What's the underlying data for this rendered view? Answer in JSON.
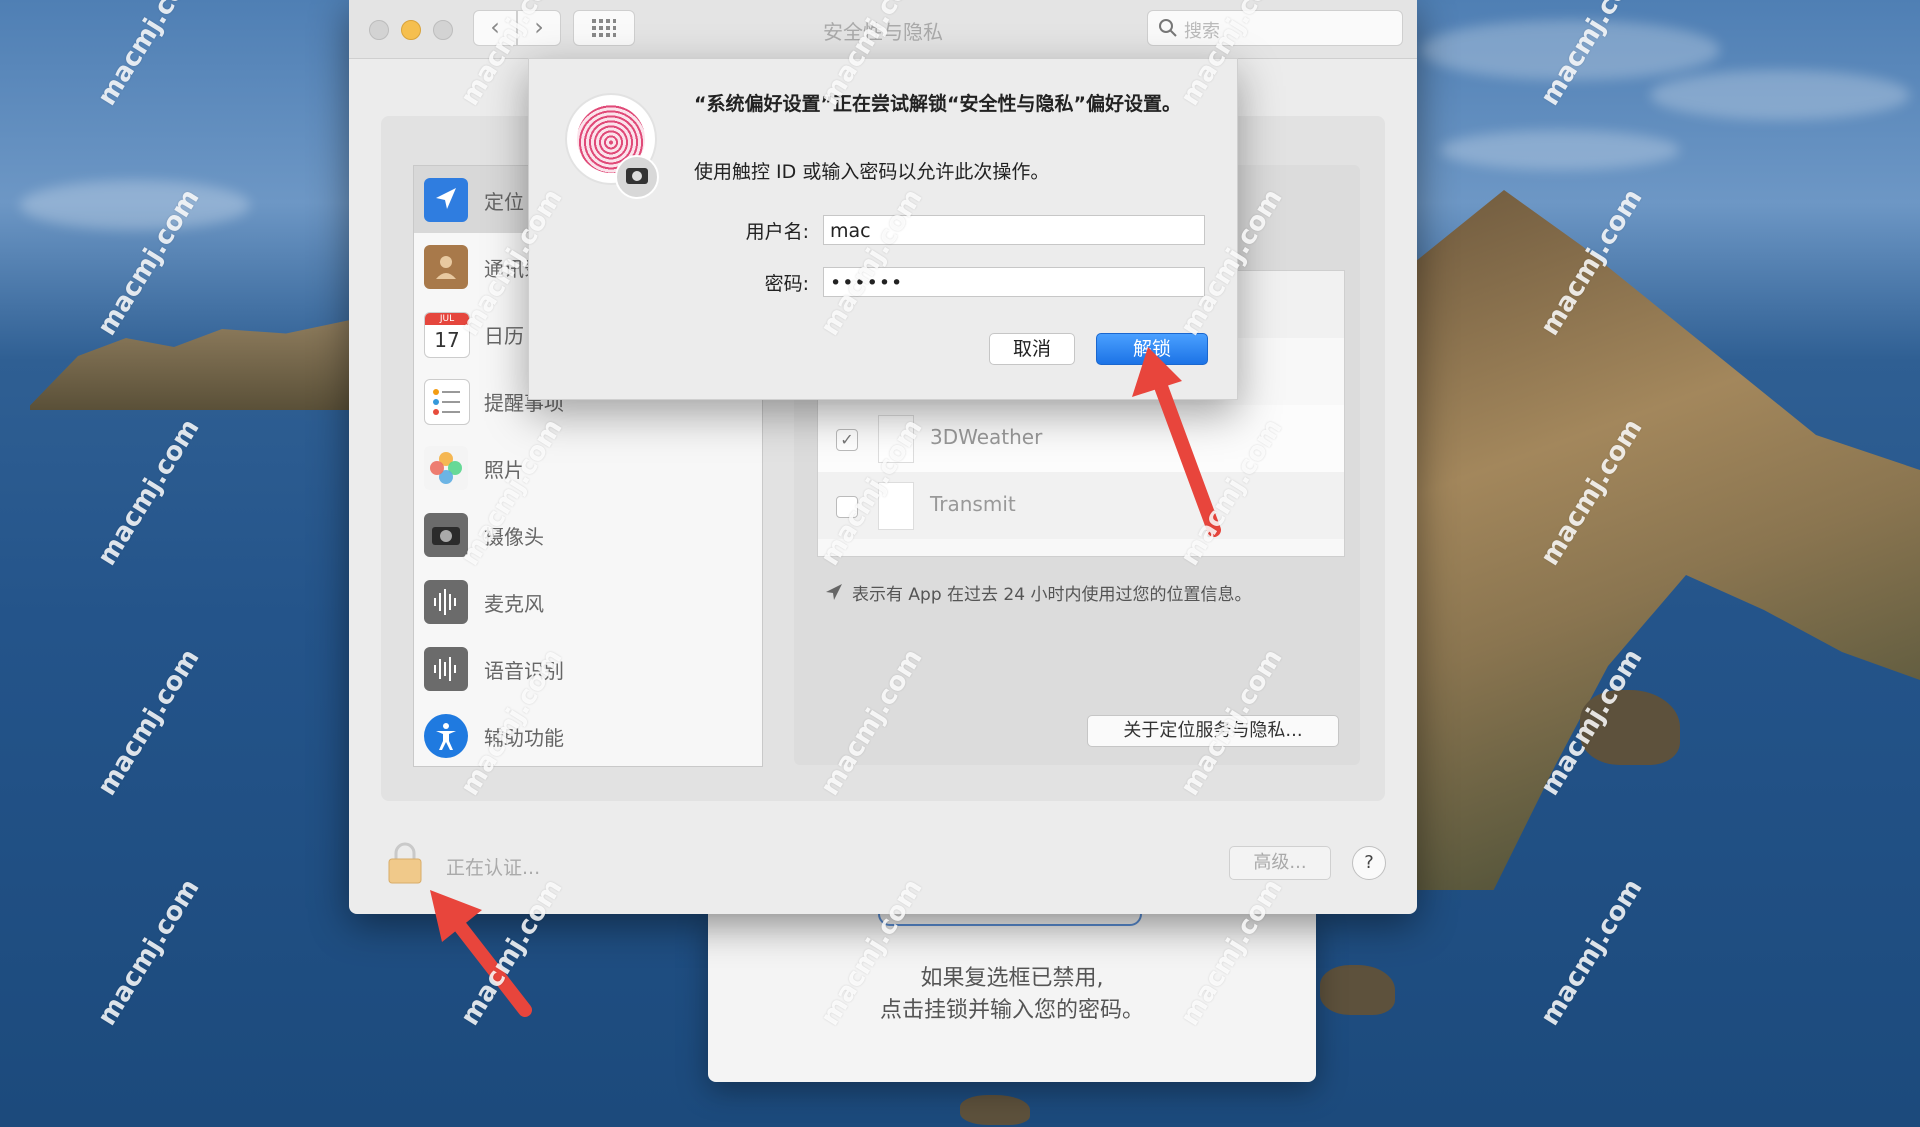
{
  "window": {
    "title": "安全性与隐私",
    "search_placeholder": "搜索"
  },
  "sidebar": {
    "items": [
      {
        "label": "定位",
        "icon": "location-arrow-icon"
      },
      {
        "label": "通讯录",
        "icon": "contacts-book-icon"
      },
      {
        "label": "日历",
        "icon": "calendar-icon"
      },
      {
        "label": "提醒事项",
        "icon": "reminders-list-icon"
      },
      {
        "label": "照片",
        "icon": "photos-flower-icon"
      },
      {
        "label": "摄像头",
        "icon": "camera-icon"
      },
      {
        "label": "麦克风",
        "icon": "microphone-waveform-icon"
      },
      {
        "label": "语音识别",
        "icon": "speech-waveform-icon"
      },
      {
        "label": "辅助功能",
        "icon": "accessibility-person-icon"
      }
    ],
    "calendar_day": "17",
    "calendar_month": "JUL"
  },
  "apps": [
    {
      "name": "3DWeather",
      "checked": true,
      "check_mark": "✓"
    },
    {
      "name": "Transmit",
      "checked": false,
      "check_mark": ""
    }
  ],
  "content": {
    "note": "表示有 App 在过去 24 小时内使用过您的位置信息。",
    "about_button": "关于定位服务与隐私..."
  },
  "footer": {
    "lock_status": "正在认证...",
    "advanced_button": "高级...",
    "help_button": "?"
  },
  "dialog": {
    "title": "“系统偏好设置”正在尝试解锁“安全性与隐私”偏好设置。",
    "subtitle": "使用触控 ID 或输入密码以允许此次操作。",
    "username_label": "用户名:",
    "username_value": "mac",
    "password_label": "密码:",
    "password_value": "••••••",
    "cancel_button": "取消",
    "unlock_button": "解锁"
  },
  "sheet": {
    "line1": "如果复选框已禁用,",
    "line2": "点击挂锁并输入您的密码。"
  },
  "watermark": "macmj.com",
  "colors": {
    "accent": "#1c73e6",
    "arrow": "#e8453c",
    "fingerprint": "#e04a78"
  }
}
